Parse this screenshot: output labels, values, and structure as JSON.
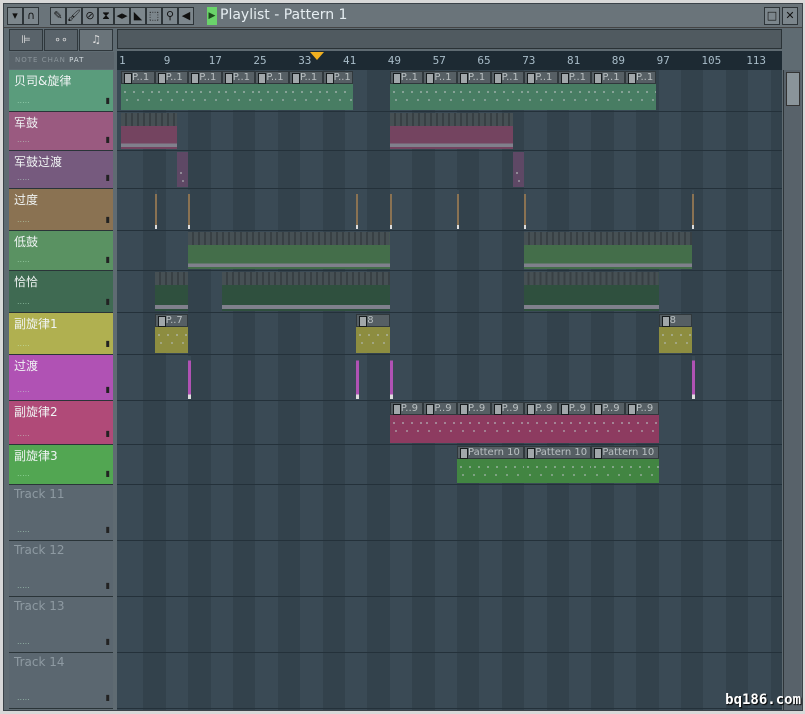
{
  "window": {
    "title": "Playlist - Pattern 1"
  },
  "toolbar": {
    "icons": [
      "menu-arrow-icon",
      "magnet-icon",
      "pencil-icon",
      "brush-icon",
      "mute-icon",
      "slip-icon",
      "slice-icon",
      "select-icon",
      "zoom-icon",
      "speaker-icon"
    ],
    "glyphs": [
      "▾",
      "∩",
      "✎",
      "🖌",
      "⊘",
      "⧗",
      "◂▸",
      "◣",
      "⬚",
      "⚲",
      "◀"
    ]
  },
  "tabs": {
    "glyphs": [
      "⊫",
      "∘∘",
      "♫"
    ],
    "filters": [
      "NOTE",
      "CHAN"
    ],
    "active_filter": "PAT"
  },
  "ruler": {
    "labels": [
      "1",
      "9",
      "17",
      "25",
      "33",
      "41",
      "49",
      "57",
      "65",
      "73",
      "81",
      "89",
      "97",
      "105",
      "113"
    ],
    "song_position_bar": 36
  },
  "tracks": [
    {
      "name": "贝司&旋律",
      "color": "#5a9c7c"
    },
    {
      "name": "军鼓",
      "color": "#9a5a80"
    },
    {
      "name": "军鼓过渡",
      "color": "#765a7e"
    },
    {
      "name": "过度",
      "color": "#8a7252"
    },
    {
      "name": "低鼓",
      "color": "#5a9262"
    },
    {
      "name": "恰恰",
      "color": "#3f6a52"
    },
    {
      "name": "副旋律1",
      "color": "#b0b050"
    },
    {
      "name": "过渡",
      "color": "#b052b4"
    },
    {
      "name": "副旋律2",
      "color": "#b04a78"
    },
    {
      "name": "副旋律3",
      "color": "#52a652"
    },
    {
      "name": "Track 11",
      "color": "#5b6770"
    },
    {
      "name": "Track 12",
      "color": "#5b6770"
    },
    {
      "name": "Track 13",
      "color": "#5b6770"
    },
    {
      "name": "Track 14",
      "color": "#5b6770"
    }
  ],
  "clips": [
    {
      "track": 0,
      "label": "P..1",
      "start": 1,
      "len": 6
    },
    {
      "track": 0,
      "label": "P..1",
      "start": 7,
      "len": 6
    },
    {
      "track": 0,
      "label": "P..1",
      "start": 13,
      "len": 6
    },
    {
      "track": 0,
      "label": "P..1",
      "start": 19,
      "len": 6
    },
    {
      "track": 0,
      "label": "P..1",
      "start": 25,
      "len": 6
    },
    {
      "track": 0,
      "label": "P..1",
      "start": 31,
      "len": 6
    },
    {
      "track": 0,
      "label": "P..1",
      "start": 37,
      "len": 5.5
    },
    {
      "track": 0,
      "label": "P..1",
      "start": 49,
      "len": 6
    },
    {
      "track": 0,
      "label": "P..1",
      "start": 55,
      "len": 6
    },
    {
      "track": 0,
      "label": "P..1",
      "start": 61,
      "len": 6
    },
    {
      "track": 0,
      "label": "P..1",
      "start": 67,
      "len": 6
    },
    {
      "track": 0,
      "label": "P..1",
      "start": 73,
      "len": 6
    },
    {
      "track": 0,
      "label": "P..1",
      "start": 79,
      "len": 6
    },
    {
      "track": 0,
      "label": "P..1",
      "start": 85,
      "len": 6
    },
    {
      "track": 0,
      "label": "P..1",
      "start": 91,
      "len": 5.5
    },
    {
      "track": 1,
      "label": "",
      "start": 1,
      "len": 10,
      "drum": true
    },
    {
      "track": 1,
      "label": "",
      "start": 49,
      "len": 22,
      "drum": true
    },
    {
      "track": 2,
      "label": "",
      "start": 11,
      "len": 2
    },
    {
      "track": 2,
      "label": "",
      "start": 71,
      "len": 2
    },
    {
      "track": 3,
      "label": "",
      "start": 7,
      "len": 0.3
    },
    {
      "track": 3,
      "label": "",
      "start": 13,
      "len": 0.3
    },
    {
      "track": 3,
      "label": "",
      "start": 43,
      "len": 0.3
    },
    {
      "track": 3,
      "label": "",
      "start": 49,
      "len": 0.3
    },
    {
      "track": 3,
      "label": "",
      "start": 61,
      "len": 0.3
    },
    {
      "track": 3,
      "label": "",
      "start": 73,
      "len": 0.3
    },
    {
      "track": 3,
      "label": "",
      "start": 103,
      "len": 0.3
    },
    {
      "track": 4,
      "label": "",
      "start": 13,
      "len": 36,
      "drum": true
    },
    {
      "track": 4,
      "label": "",
      "start": 73,
      "len": 30,
      "drum": true
    },
    {
      "track": 5,
      "label": "",
      "start": 7,
      "len": 6,
      "drum": true
    },
    {
      "track": 5,
      "label": "",
      "start": 19,
      "len": 30,
      "drum": true
    },
    {
      "track": 5,
      "label": "",
      "start": 73,
      "len": 24,
      "drum": true
    },
    {
      "track": 6,
      "label": "P..7",
      "start": 7,
      "len": 6
    },
    {
      "track": 6,
      "label": "8",
      "start": 43,
      "len": 6
    },
    {
      "track": 6,
      "label": "8",
      "start": 97,
      "len": 6
    },
    {
      "track": 7,
      "label": "",
      "start": 13,
      "len": 0.5
    },
    {
      "track": 7,
      "label": "",
      "start": 43,
      "len": 0.5
    },
    {
      "track": 7,
      "label": "",
      "start": 49,
      "len": 0.5
    },
    {
      "track": 7,
      "label": "",
      "start": 103,
      "len": 0.5
    },
    {
      "track": 8,
      "label": "P..9",
      "start": 49,
      "len": 6
    },
    {
      "track": 8,
      "label": "P..9",
      "start": 55,
      "len": 6
    },
    {
      "track": 8,
      "label": "P..9",
      "start": 61,
      "len": 6
    },
    {
      "track": 8,
      "label": "P..9",
      "start": 67,
      "len": 6
    },
    {
      "track": 8,
      "label": "P..9",
      "start": 73,
      "len": 6
    },
    {
      "track": 8,
      "label": "P..9",
      "start": 79,
      "len": 6
    },
    {
      "track": 8,
      "label": "P..9",
      "start": 85,
      "len": 6
    },
    {
      "track": 8,
      "label": "P..9",
      "start": 91,
      "len": 6
    },
    {
      "track": 9,
      "label": "Pattern 10",
      "start": 61,
      "len": 12
    },
    {
      "track": 9,
      "label": "Pattern 10",
      "start": 73,
      "len": 12
    },
    {
      "track": 9,
      "label": "Pattern 10",
      "start": 85,
      "len": 12
    }
  ],
  "watermark": "bq186.com"
}
